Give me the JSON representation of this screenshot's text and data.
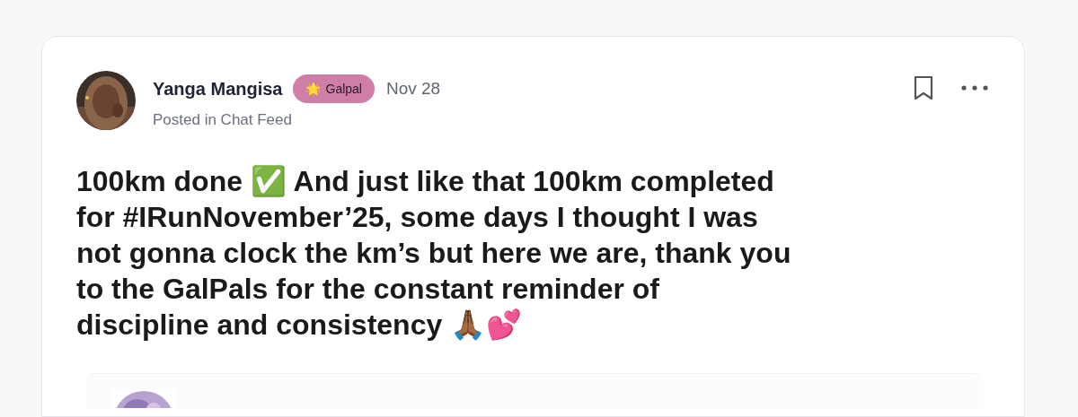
{
  "post": {
    "author": "Yanga Mangisa",
    "badge": {
      "icon": "🌟",
      "label": "Galpal"
    },
    "date": "Nov 28",
    "posted_in": "Posted in Chat Feed",
    "bookmarked": false,
    "body": "100km done ✅ And just like that 100km completed for #IRunNovember’25, some days I thought I was not gonna clock the km’s but here we are, thank you to the GalPals for the constant reminder of discipline and consistency 🙏🏾💕"
  }
}
